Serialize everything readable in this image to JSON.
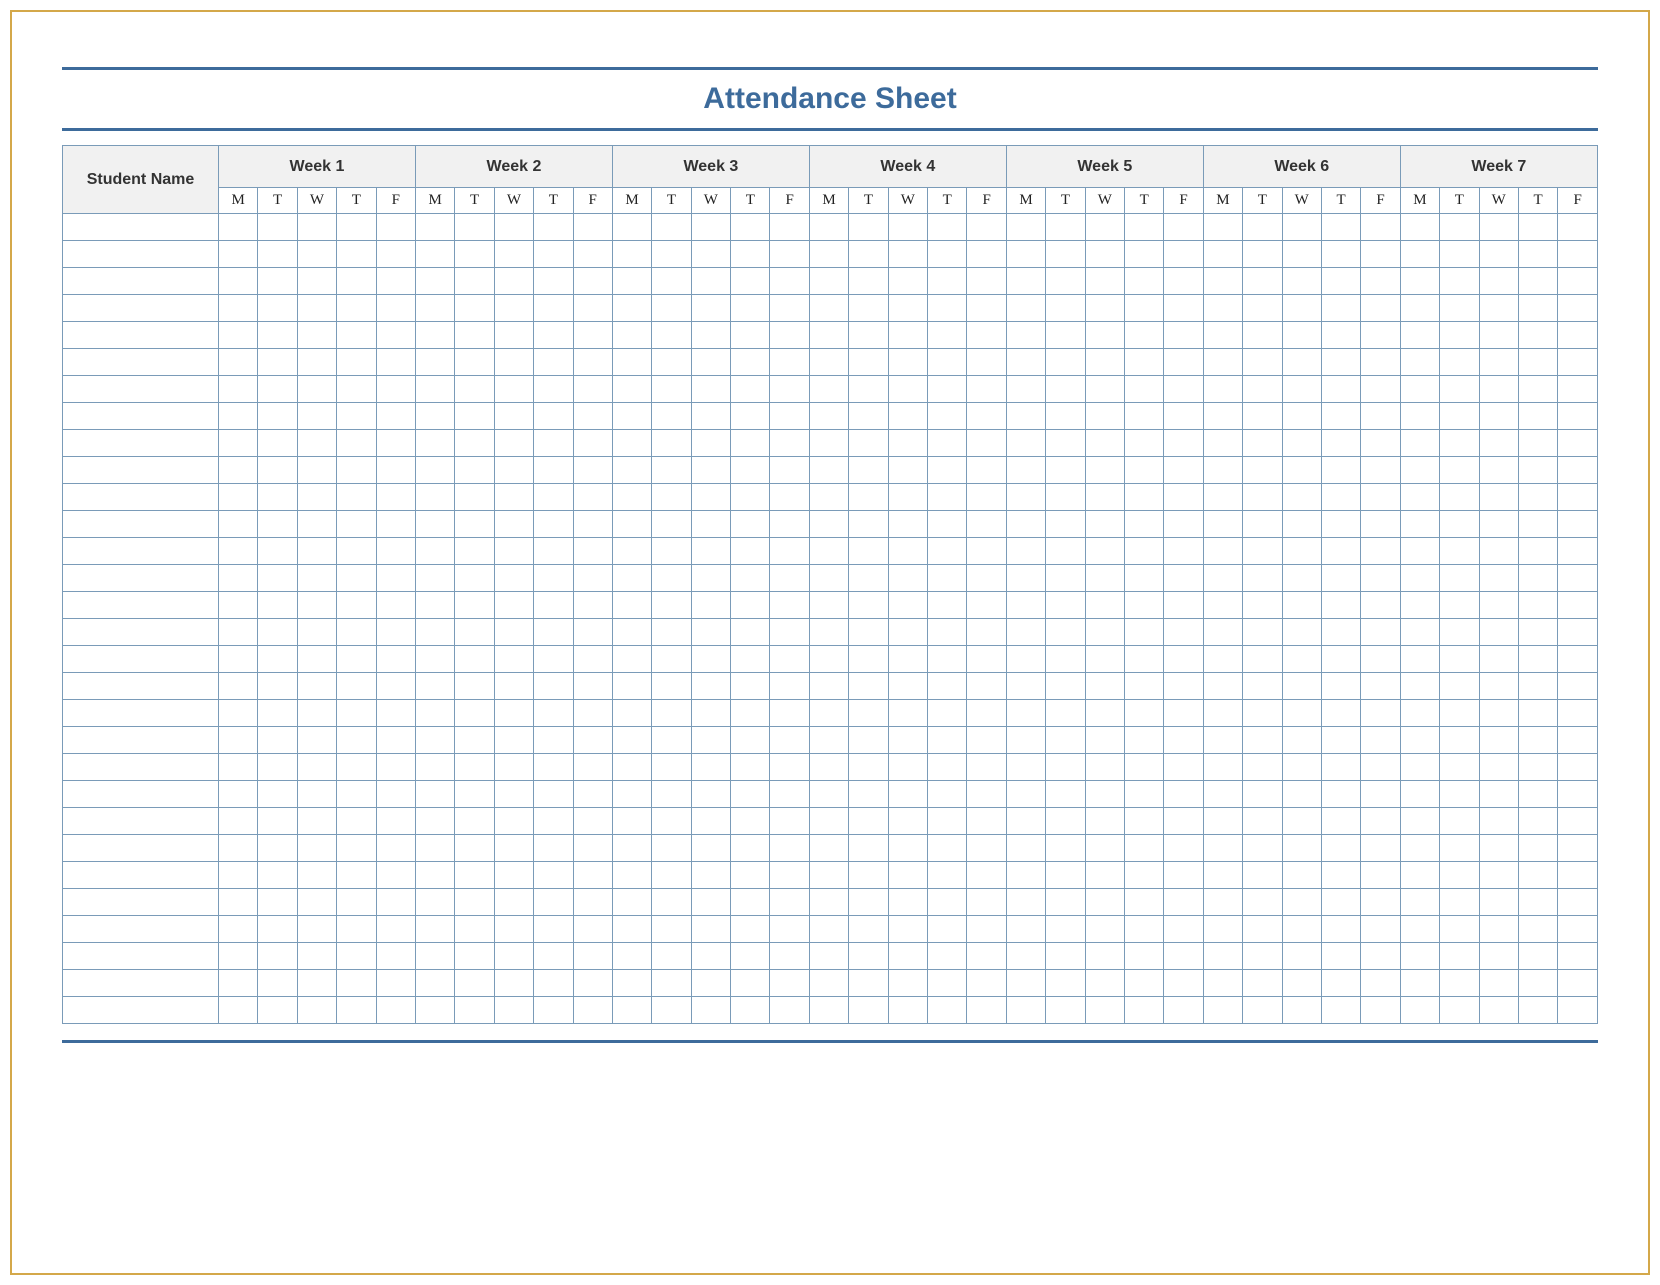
{
  "title": "Attendance Sheet",
  "headers": {
    "name": "Student Name",
    "weeks": [
      "Week 1",
      "Week 2",
      "Week 3",
      "Week 4",
      "Week 5",
      "Week 6",
      "Week 7"
    ],
    "days": [
      "M",
      "T",
      "W",
      "T",
      "F"
    ]
  },
  "row_count": 30
}
